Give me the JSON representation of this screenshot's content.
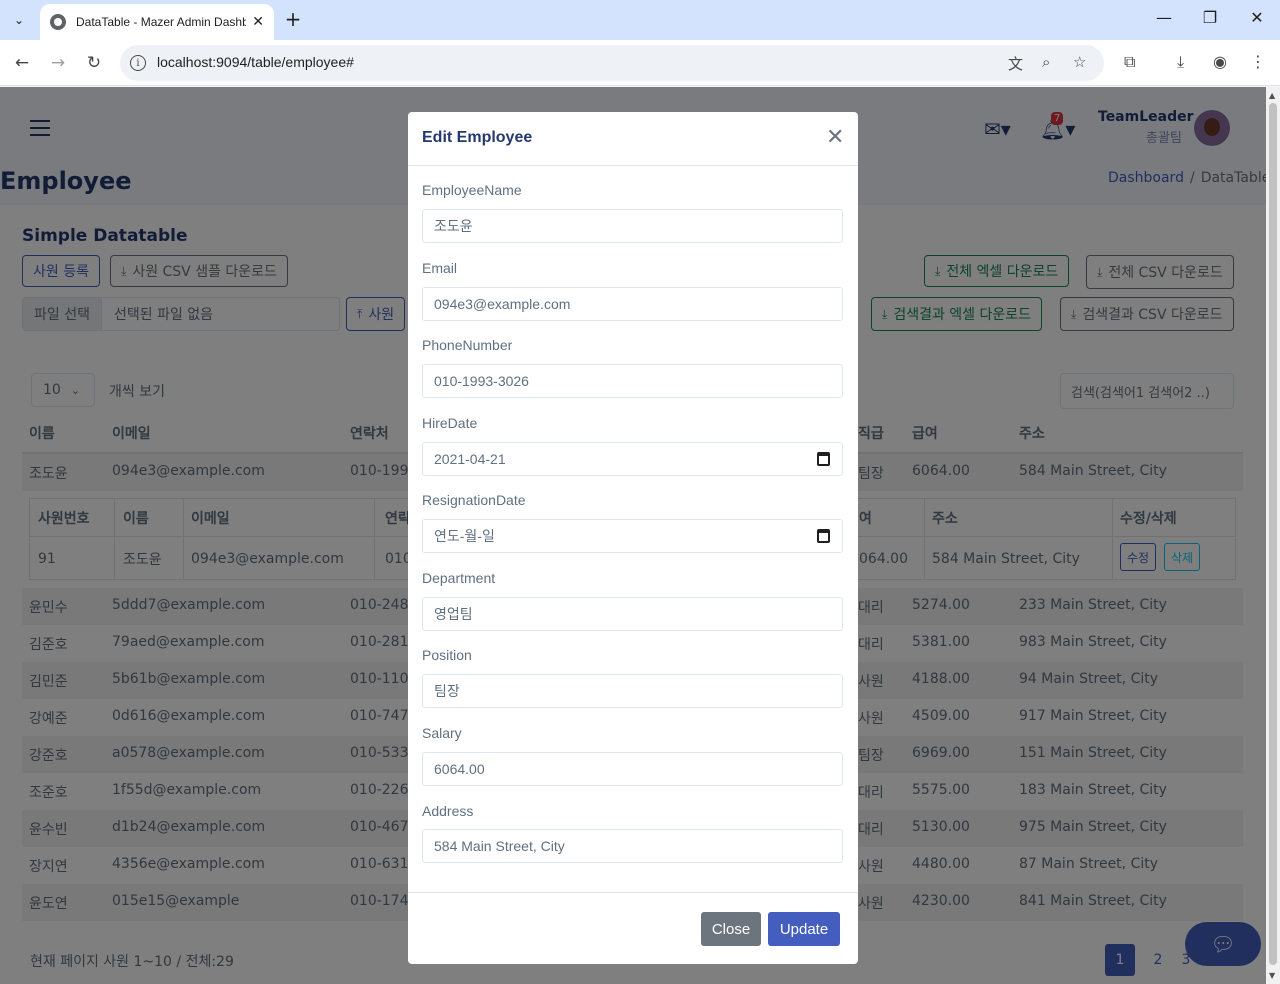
{
  "browser": {
    "tab_title": "DataTable - Mazer Admin Dashboard",
    "url": "localhost:9094/table/employee#"
  },
  "header": {
    "user_name": "TeamLeader",
    "user_role": "총괄팀",
    "notification_count": "7"
  },
  "page": {
    "title": "Employee",
    "breadcrumb": [
      "Dashboard",
      "DataTable"
    ],
    "card_title": "Simple Datatable"
  },
  "buttons": {
    "register": "사원 등록",
    "sample_csv": "사원 CSV 샘플 다운로드",
    "file_select": "파일 선택",
    "file_none": "선택된 파일 없음",
    "upload": "사원",
    "all_excel": "전체 엑셀 다운로드",
    "all_csv": "전체 CSV 다운로드",
    "search_excel": "검색결과 엑셀 다운로드",
    "search_csv": "검색결과 CSV 다운로드"
  },
  "table": {
    "per_page": "10",
    "per_page_label": "개씩 보기",
    "search_placeholder": "검색(검색어1 검색어2 ..)",
    "columns": [
      "이름",
      "이메일",
      "연락처",
      "직급",
      "급여",
      "주소"
    ],
    "rows": [
      {
        "name": "조도윤",
        "email": "094e3@example.com",
        "phone": "010-199",
        "pos": "팀장",
        "salary": "6064.00",
        "addr": "584 Main Street, City"
      },
      {
        "name": "윤민수",
        "email": "5ddd7@example.com",
        "phone": "010-248",
        "pos": "대리",
        "salary": "5274.00",
        "addr": "233 Main Street, City"
      },
      {
        "name": "김준호",
        "email": "79aed@example.com",
        "phone": "010-281",
        "pos": "대리",
        "salary": "5381.00",
        "addr": "983 Main Street, City"
      },
      {
        "name": "김민준",
        "email": "5b61b@example.com",
        "phone": "010-110",
        "pos": "사원",
        "salary": "4188.00",
        "addr": "94 Main Street, City"
      },
      {
        "name": "강예준",
        "email": "0d616@example.com",
        "phone": "010-747",
        "pos": "사원",
        "salary": "4509.00",
        "addr": "917 Main Street, City"
      },
      {
        "name": "강준호",
        "email": "a0578@example.com",
        "phone": "010-533",
        "pos": "팀장",
        "salary": "6969.00",
        "addr": "151 Main Street, City"
      },
      {
        "name": "조준호",
        "email": "1f55d@example.com",
        "phone": "010-226",
        "pos": "대리",
        "salary": "5575.00",
        "addr": "183 Main Street, City"
      },
      {
        "name": "윤수빈",
        "email": "d1b24@example.com",
        "phone": "010-467",
        "pos": "대리",
        "salary": "5130.00",
        "addr": "975 Main Street, City"
      },
      {
        "name": "장지연",
        "email": "4356e@example.com",
        "phone": "010-631",
        "pos": "사원",
        "salary": "4480.00",
        "addr": "87 Main Street, City"
      },
      {
        "name": "윤도연",
        "email": "015e15@example",
        "phone": "010-174",
        "pos": "사원",
        "salary": "4230.00",
        "addr": "841 Main Street, City"
      }
    ],
    "detail": {
      "headers": [
        "사원번호",
        "이름",
        "이메일",
        "연락",
        "여",
        "주소",
        "수정/삭제"
      ],
      "id": "91",
      "name": "조도윤",
      "email": "094e3@example.com",
      "phone": "010",
      "salary": "064.00",
      "addr": "584 Main Street, City",
      "edit": "수정",
      "delete": "삭제"
    },
    "footer_info": "현재 페이지 사원 1~10 / 전체:29",
    "pages": [
      "1",
      "2",
      "3"
    ]
  },
  "modal": {
    "title": "Edit Employee",
    "fields": [
      {
        "label": "EmployeeName",
        "value": "조도윤"
      },
      {
        "label": "Email",
        "value": "094e3@example.com"
      },
      {
        "label": "PhoneNumber",
        "value": "010-1993-3026"
      },
      {
        "label": "HireDate",
        "value": "2021-04-21"
      },
      {
        "label": "ResignationDate",
        "value": "연도-월-일"
      },
      {
        "label": "Department",
        "value": "영업팀"
      },
      {
        "label": "Position",
        "value": "팀장"
      },
      {
        "label": "Salary",
        "value": "6064.00"
      },
      {
        "label": "Address",
        "value": "584 Main Street, City"
      }
    ],
    "close_label": "Close",
    "update_label": "Update"
  }
}
